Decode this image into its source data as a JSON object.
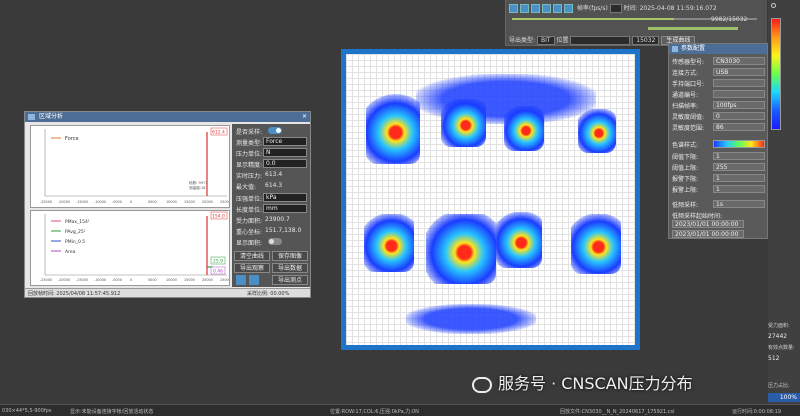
{
  "playback": {
    "speed_label": "帧率(fps/s)",
    "time_label": "时间:",
    "time_value": "2025-04-08 11:59:16.072",
    "frame_counter": "9982/15032",
    "frame_value": "15032",
    "export_label": "导出类型:",
    "export_value": "BIT",
    "position_label": "位置",
    "gen_curve_button": "生成曲线"
  },
  "area_window": {
    "title": "区域分析",
    "top_chart": {
      "legend": [
        "Force"
      ],
      "x_ticks": [
        "-25000",
        "-20000",
        "-15000",
        "-10000",
        "-5000",
        "0",
        "5000",
        "10000",
        "15000",
        "20000",
        "25000"
      ],
      "marker_value": "612.4",
      "cursor_frame": "帧数: 9971",
      "cursor_value": "测量值:16"
    },
    "bottom_chart": {
      "legend": [
        "PMax_154¹",
        "PAvg_25¹",
        "PMin_0.5",
        "Area"
      ],
      "x_ticks": [
        "-25000",
        "-20000",
        "-15000",
        "-10000",
        "-5000",
        "0",
        "5000",
        "10000",
        "15000",
        "20000",
        "25000"
      ],
      "marker_top": "154.0",
      "marker_mid": "25.9",
      "marker_low": "0.46"
    },
    "fields": [
      {
        "label": "是否采样:",
        "value": ""
      },
      {
        "label": "测量类型:",
        "value": "Force"
      },
      {
        "label": "压力单位:",
        "value": "N"
      },
      {
        "label": "显示精度:",
        "value": "0.0"
      },
      {
        "label": "实时压力:",
        "value": "613.4"
      },
      {
        "label": "最大值:",
        "value": "614.3"
      },
      {
        "label": "压强单位:",
        "value": "kPa"
      },
      {
        "label": "长度单位:",
        "value": "mm"
      },
      {
        "label": "受力面积:",
        "value": "23900.7"
      },
      {
        "label": "重心坐标:",
        "value": "151.7,138.0"
      },
      {
        "label": "显示面积:",
        "value": ""
      }
    ],
    "buttons": [
      "清空曲线",
      "保存图像",
      "导出观察",
      "导出数据",
      "导出测点"
    ],
    "footer_time": "回放帧时间: 2025/04/08 11:57:45.912",
    "footer_sample": "采样比例: 00.00%"
  },
  "param_panel": {
    "title": "参数配置",
    "fields": [
      {
        "label": "传感器型号:",
        "value": "CN3030"
      },
      {
        "label": "连接方式:",
        "value": "USB"
      },
      {
        "label": "手持端口号:",
        "value": ""
      },
      {
        "label": "通道编号:",
        "value": ""
      },
      {
        "label": "扫描帧率:",
        "value": "100fps"
      },
      {
        "label": "灵敏度阈值:",
        "value": "0"
      },
      {
        "label": "灵敏度范围:",
        "value": "86"
      }
    ],
    "color_label": "色谱样式:",
    "thresholds": [
      {
        "label": "阈值下限:",
        "value": "1"
      },
      {
        "label": "阈值上限:",
        "value": "255"
      },
      {
        "label": "报警下限:",
        "value": "1"
      },
      {
        "label": "报警上限:",
        "value": "1"
      }
    ],
    "sample_label": "低频采样:",
    "sample_value": "1s",
    "range_label": "低频采样起始时间:",
    "range_start": "2023/01/01 00:00:00",
    "range_end": "2023/01/01 00:00:00"
  },
  "right_stats": {
    "stat1_label": "受力面积:",
    "stat1_value": "27442",
    "stat2_label": "有效点数量:",
    "stat2_value": "512",
    "stat3_label": "压力占比:",
    "progress": "100%",
    "progress_fraction": 1.0
  },
  "status": {
    "left": "030×44*5,5-900fps",
    "hint": "显示:未能设备连接字帐/回放活动状态",
    "pos": "位置:ROW:17,COL:6,压强:0kPa,力:0N",
    "file": "回放文件:CN3030__N_N_20240617_175921.csl",
    "time": "运行时间:0:00:08:19"
  },
  "watermark": "服务号 · CNSCAN压力分布"
}
